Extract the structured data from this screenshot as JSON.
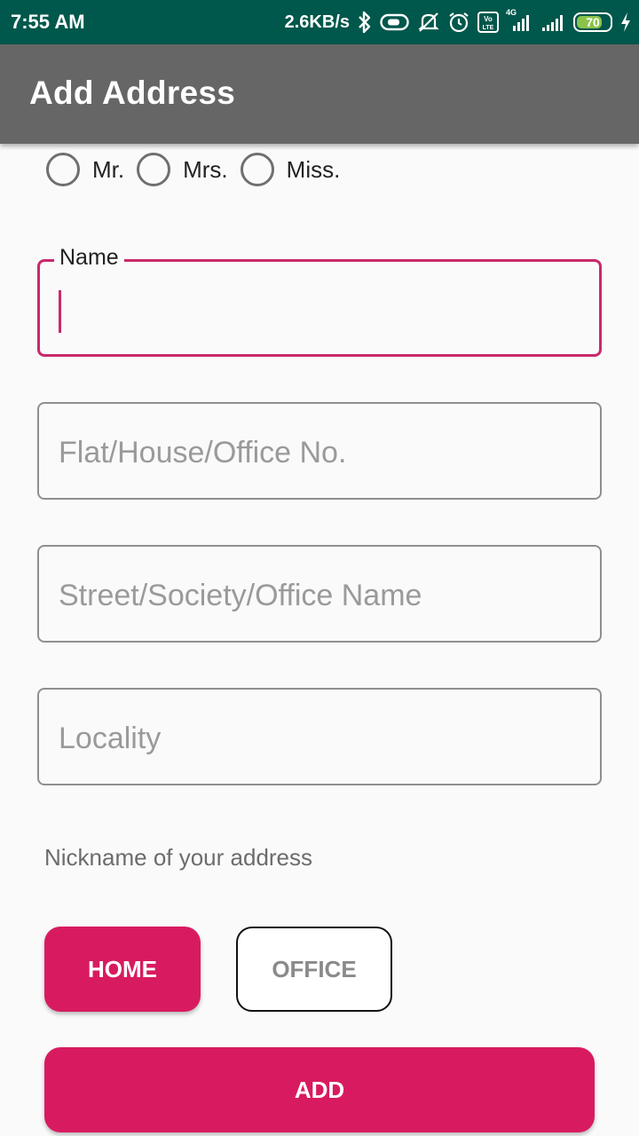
{
  "status_bar": {
    "time": "7:55 AM",
    "net_speed": "2.6KB/s",
    "network_type": "4G",
    "volte_label": "Vo LTE",
    "battery_level": "70",
    "icons": [
      "bluetooth-icon",
      "key-icon",
      "mute-icon",
      "alarm-icon",
      "volte-icon",
      "signal-icon",
      "signal-icon",
      "battery-icon",
      "charging-icon"
    ]
  },
  "app_bar": {
    "title": "Add Address"
  },
  "salutation": {
    "options": [
      {
        "label": "Mr.",
        "selected": false
      },
      {
        "label": "Mrs.",
        "selected": false
      },
      {
        "label": "Miss.",
        "selected": false
      }
    ]
  },
  "form": {
    "name": {
      "label": "Name",
      "value": ""
    },
    "flat": {
      "placeholder": "Flat/House/Office No.",
      "value": ""
    },
    "street": {
      "placeholder": "Street/Society/Office Name",
      "value": ""
    },
    "locality": {
      "placeholder": "Locality",
      "value": ""
    }
  },
  "nickname": {
    "label": "Nickname of your address",
    "options": [
      {
        "label": "HOME",
        "selected": true
      },
      {
        "label": "OFFICE",
        "selected": false
      }
    ]
  },
  "actions": {
    "add_label": "ADD"
  },
  "colors": {
    "status_bar": "#00574b",
    "app_bar": "#666666",
    "accent": "#d81b60",
    "focus_border": "#c9296a",
    "background": "#fafafa"
  }
}
